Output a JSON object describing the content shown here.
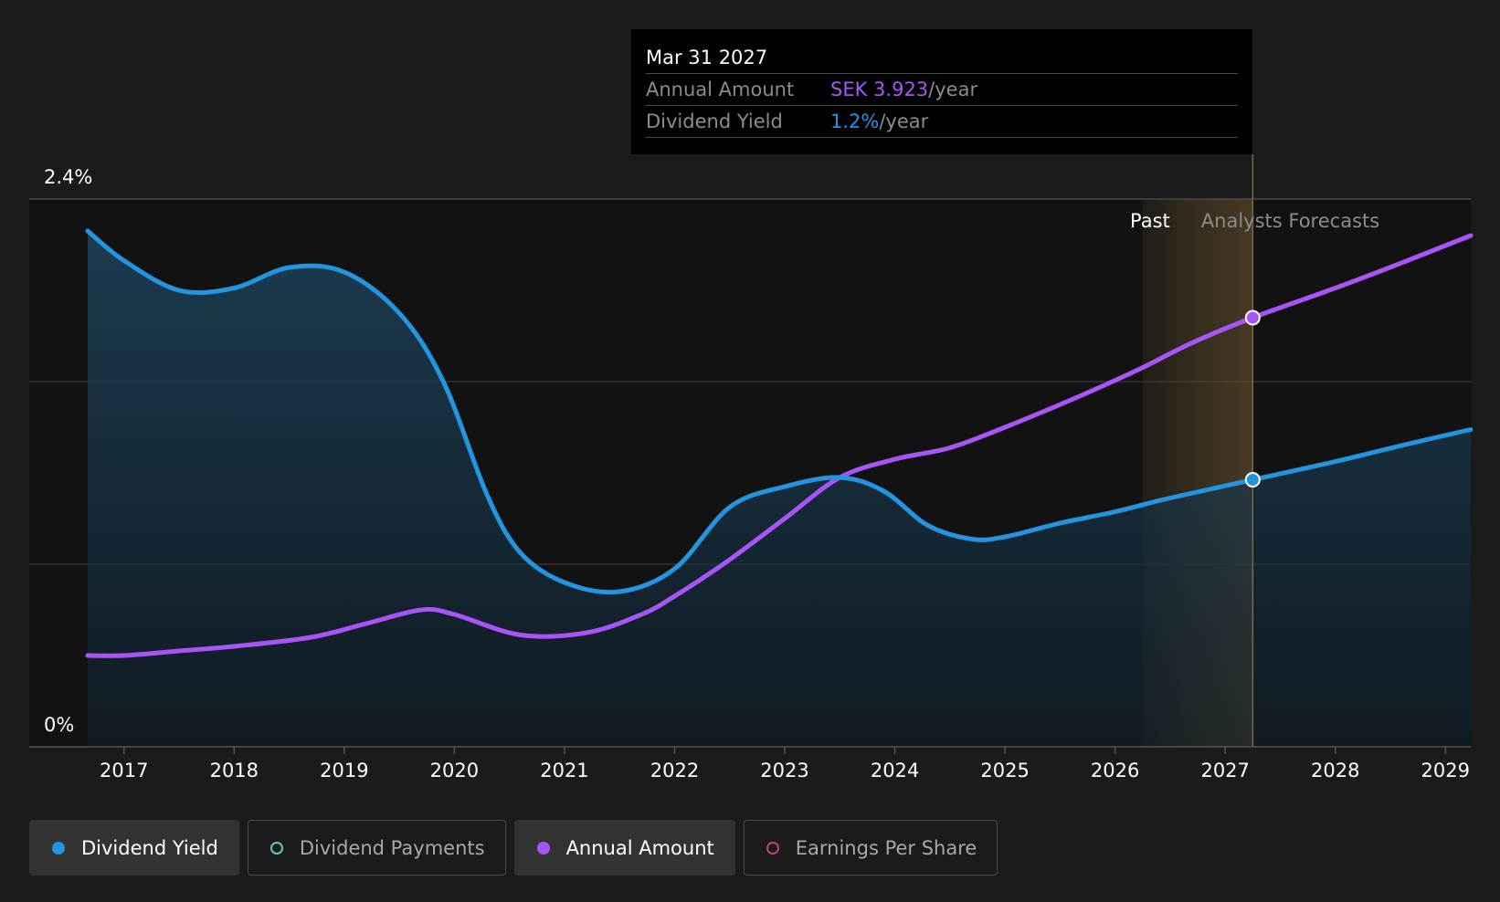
{
  "tooltip": {
    "date": "Mar 31 2027",
    "rows": [
      {
        "label": "Annual Amount",
        "value": "SEK 3.923",
        "suffix": "/year",
        "color": "#a855f7"
      },
      {
        "label": "Dividend Yield",
        "value": "1.2%",
        "suffix": "/year",
        "color": "#2394df"
      }
    ]
  },
  "legend": [
    {
      "label": "Dividend Yield",
      "color": "#2394df",
      "filled": true,
      "active": true
    },
    {
      "label": "Dividend Payments",
      "color": "#5fc9bb",
      "filled": false,
      "active": false
    },
    {
      "label": "Annual Amount",
      "color": "#a855f7",
      "filled": true,
      "active": true
    },
    {
      "label": "Earnings Per Share",
      "color": "#c2417e",
      "filled": false,
      "active": false
    }
  ],
  "chart_data": {
    "type": "line",
    "y_axis": {
      "min": 0,
      "max": 2.4,
      "tick_labels": [
        "2.4%",
        "0%"
      ]
    },
    "x_axis": {
      "ticks": [
        "2017",
        "2018",
        "2019",
        "2020",
        "2021",
        "2022",
        "2023",
        "2024",
        "2025",
        "2026",
        "2027",
        "2028",
        "2029"
      ],
      "range": [
        2016.67,
        2029.23
      ]
    },
    "regions": {
      "past_label": "Past",
      "forecast_label": "Analysts Forecasts",
      "highlight_start": 2026.25,
      "highlight_end": 2027.25
    },
    "hover_x": 2027.25,
    "series": [
      {
        "name": "Dividend Yield",
        "color": "#2394df",
        "fill": true,
        "points": [
          [
            2016.67,
            2.26
          ],
          [
            2017.0,
            2.13
          ],
          [
            2017.5,
            2.0
          ],
          [
            2018.0,
            2.01
          ],
          [
            2018.5,
            2.1
          ],
          [
            2019.0,
            2.08
          ],
          [
            2019.5,
            1.9
          ],
          [
            2019.9,
            1.6
          ],
          [
            2020.3,
            1.1
          ],
          [
            2020.6,
            0.85
          ],
          [
            2021.0,
            0.72
          ],
          [
            2021.5,
            0.68
          ],
          [
            2022.0,
            0.78
          ],
          [
            2022.5,
            1.05
          ],
          [
            2023.0,
            1.14
          ],
          [
            2023.5,
            1.18
          ],
          [
            2023.9,
            1.12
          ],
          [
            2024.3,
            0.97
          ],
          [
            2024.7,
            0.91
          ],
          [
            2025.0,
            0.92
          ],
          [
            2025.5,
            0.98
          ],
          [
            2026.0,
            1.03
          ],
          [
            2026.5,
            1.09
          ],
          [
            2027.25,
            1.17
          ],
          [
            2028.0,
            1.25
          ],
          [
            2028.6,
            1.32
          ],
          [
            2029.23,
            1.39
          ]
        ]
      },
      {
        "name": "Annual Amount",
        "color": "#a855f7",
        "fill": false,
        "points": [
          [
            2016.67,
            0.4
          ],
          [
            2017.0,
            0.4
          ],
          [
            2017.5,
            0.42
          ],
          [
            2018.0,
            0.44
          ],
          [
            2018.7,
            0.48
          ],
          [
            2019.2,
            0.54
          ],
          [
            2019.7,
            0.6
          ],
          [
            2020.0,
            0.58
          ],
          [
            2020.6,
            0.49
          ],
          [
            2021.2,
            0.5
          ],
          [
            2021.7,
            0.58
          ],
          [
            2022.0,
            0.66
          ],
          [
            2022.5,
            0.82
          ],
          [
            2023.0,
            1.0
          ],
          [
            2023.5,
            1.18
          ],
          [
            2024.0,
            1.26
          ],
          [
            2024.5,
            1.31
          ],
          [
            2025.0,
            1.4
          ],
          [
            2025.6,
            1.52
          ],
          [
            2026.2,
            1.65
          ],
          [
            2026.7,
            1.77
          ],
          [
            2027.25,
            1.88
          ],
          [
            2028.0,
            2.01
          ],
          [
            2028.6,
            2.12
          ],
          [
            2029.23,
            2.24
          ]
        ]
      }
    ]
  }
}
